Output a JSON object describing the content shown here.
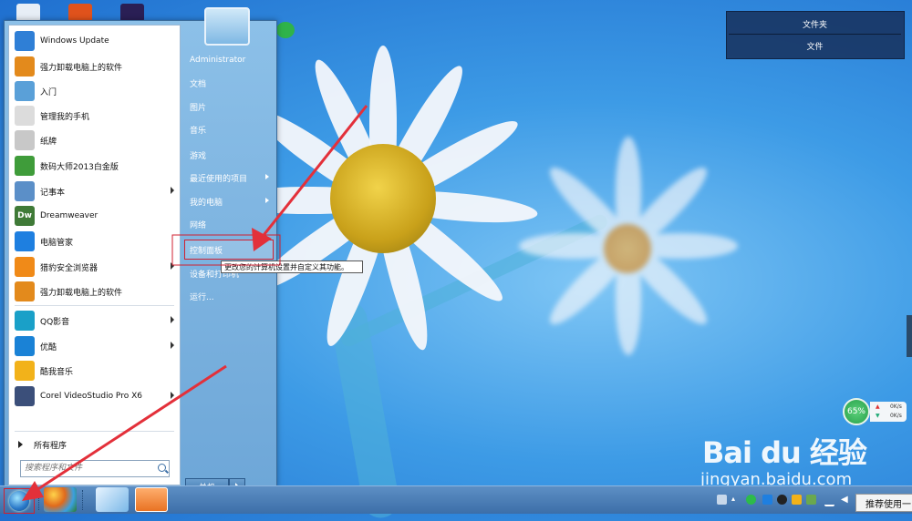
{
  "start_menu": {
    "programs": [
      {
        "label": "Windows Update",
        "color": "#2f7fd6"
      },
      {
        "label": "强力卸载电脑上的软件",
        "color": "#e38a1c"
      },
      {
        "label": "入门",
        "color": "#5aa0d8"
      },
      {
        "label": "管理我的手机",
        "color": "#dcdcdc"
      },
      {
        "label": "纸牌",
        "color": "#c8c8c8"
      },
      {
        "label": "数码大师2013白金版",
        "color": "#3f9c3a"
      },
      {
        "label": "记事本",
        "color": "#5b8fc8",
        "submenu": true
      },
      {
        "label": "Dreamweaver",
        "color": "#3f7a37",
        "glyph": "Dw"
      },
      {
        "label": "电脑管家",
        "color": "#1e7fe0"
      },
      {
        "label": "猎豹安全浏览器",
        "color": "#f08a18",
        "submenu": true
      },
      {
        "label": "强力卸载电脑上的软件",
        "color": "#e38a1c"
      },
      {
        "label": "QQ影音",
        "color": "#1aa0c8",
        "submenu": true
      },
      {
        "label": "优酷",
        "color": "#1a82d6",
        "submenu": true
      },
      {
        "label": "酷我音乐",
        "color": "#f2b21a"
      },
      {
        "label": "Corel VideoStudio Pro X6",
        "color": "#3b4f7a",
        "submenu": true
      }
    ],
    "all_programs": "所有程序",
    "search_placeholder": "搜索程序和文件",
    "right_items": [
      {
        "label": "Administrator"
      },
      {
        "label": "文档"
      },
      {
        "label": "图片"
      },
      {
        "label": "音乐"
      },
      {
        "label": "游戏"
      },
      {
        "label": "最近使用的项目",
        "submenu": true
      },
      {
        "label": "我的电脑",
        "submenu": true
      },
      {
        "label": "网络"
      },
      {
        "label": "控制面板"
      },
      {
        "label": "设备和打印机"
      },
      {
        "label": "运行..."
      }
    ],
    "shutdown": "关机",
    "tooltip": "更改您的计算机设置并自定义其功能。"
  },
  "top_panel": {
    "btn1": "文件夹",
    "btn2": "文件"
  },
  "widget": {
    "percent": "65%",
    "up": "0K/s",
    "down": "0K/s"
  },
  "watermark": {
    "logo": "Bai du 经验",
    "url": "jingyan.baidu.com"
  },
  "taskbar": {
    "recommend": "推荐使用一"
  },
  "accent": "#d02030"
}
